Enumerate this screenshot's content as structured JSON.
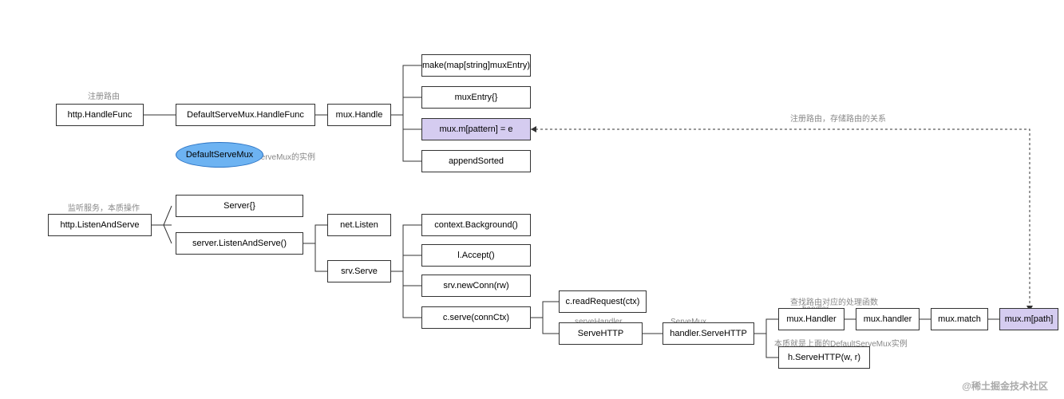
{
  "labels": {
    "top1": "注册路由",
    "top2": "监听服务，本质操作",
    "defaultmux_note": "是ServeMux的实例",
    "top3": "注册路由，存储路由的关系",
    "top4": "查找路由对应的处理函数",
    "top5": "本质就是上面的DefaultServeMux实例"
  },
  "nodes": {
    "httpHandleFunc": "http.HandleFunc",
    "httpListenAndServe": "http.ListenAndServe",
    "defaultServeMux": "DefaultServeMux",
    "dsmHandleFunc": "DefaultServeMux.HandleFunc",
    "server": "Server{}",
    "serverListenAndServe": "server.ListenAndServe()",
    "muxHandle": "mux.Handle",
    "netListen": "net.Listen",
    "srvServe": "srv.Serve",
    "makeMap": "make(map[string]muxEntry)",
    "muxEntry": "muxEntry{}",
    "muxMpattern": "mux.m[pattern] = e",
    "appendSorted": "appendSorted",
    "contextBackground": "context.Background()",
    "lAccept": "l.Accept()",
    "srvNewConn": "srv.newConn(rw)",
    "cServe": "c.serve(connCtx)",
    "cReadRequest": "c.readRequest(ctx)",
    "serveHTTP": "ServeHTTP",
    "handlerServeHTTP": "handler.ServeHTTP",
    "hServeHTTP": "h.ServeHTTP(w, r)",
    "muxHandler1": "mux.Handler",
    "muxHandler2": "mux.handler",
    "muxMatch": "mux.match",
    "muxMpath": "mux.m[path]"
  },
  "midlabels": {
    "serveHandler": "serveHandler",
    "serveMux": "ServeMux",
    "handler": "handler"
  },
  "watermark": "@稀土掘金技术社区"
}
